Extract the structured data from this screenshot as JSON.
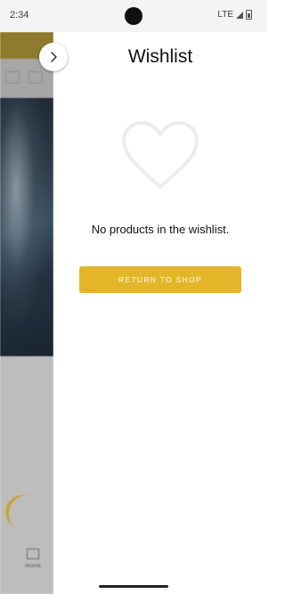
{
  "status_bar": {
    "time": "2:34",
    "network": "LTE",
    "icons": [
      "signal-icon",
      "battery-icon"
    ]
  },
  "drawer": {
    "title": "Wishlist",
    "close_icon": "chevron-right-icon",
    "empty_icon": "heart-outline-icon",
    "empty_message": "No products in the wishlist.",
    "return_button_label": "RETURN TO SHOP"
  },
  "background_page": {
    "tab_label": "Home"
  },
  "colors": {
    "accent": "#e3b62a",
    "title": "#111111",
    "heart_outline": "#ededed"
  }
}
